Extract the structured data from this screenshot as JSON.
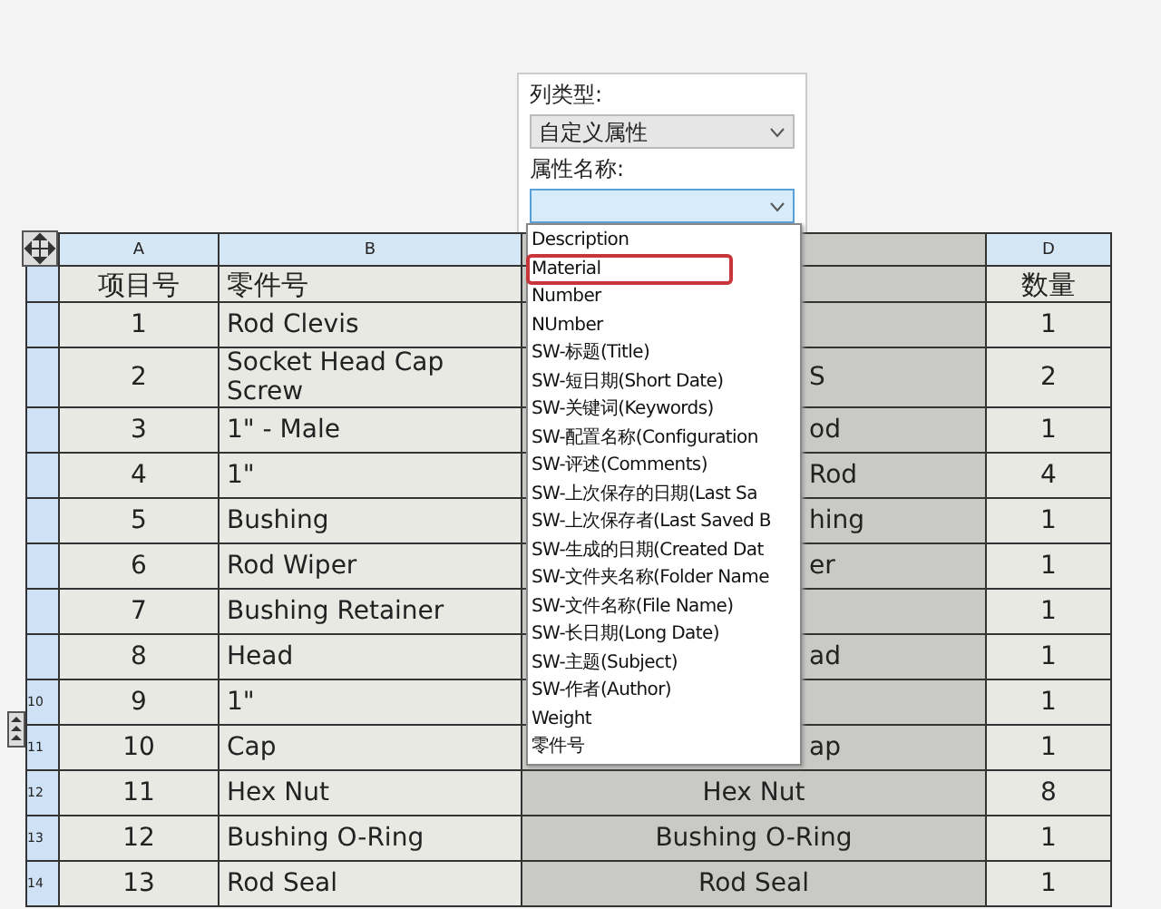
{
  "column_panel": {
    "column_type_label": "列类型:",
    "column_type_value": "自定义属性",
    "property_name_label": "属性名称:"
  },
  "property_dropdown": {
    "items": [
      {
        "label": "Description",
        "highlighted": false
      },
      {
        "label": "Material",
        "highlighted": true
      },
      {
        "label": "Number",
        "highlighted": false
      },
      {
        "label": "NUmber",
        "highlighted": false
      },
      {
        "label": "SW-标题(Title)",
        "highlighted": false
      },
      {
        "label": "SW-短日期(Short Date)",
        "highlighted": false
      },
      {
        "label": "SW-关键词(Keywords)",
        "highlighted": false
      },
      {
        "label": "SW-配置名称(Configuration",
        "highlighted": false
      },
      {
        "label": "SW-评述(Comments)",
        "highlighted": false
      },
      {
        "label": "SW-上次保存的日期(Last Sa",
        "highlighted": false
      },
      {
        "label": "SW-上次保存者(Last Saved B",
        "highlighted": false
      },
      {
        "label": "SW-生成的日期(Created Dat",
        "highlighted": false
      },
      {
        "label": "SW-文件夹名称(Folder Name",
        "highlighted": false
      },
      {
        "label": "SW-文件名称(File Name)",
        "highlighted": false
      },
      {
        "label": "SW-长日期(Long Date)",
        "highlighted": false
      },
      {
        "label": "SW-主题(Subject)",
        "highlighted": false
      },
      {
        "label": "SW-作者(Author)",
        "highlighted": false
      },
      {
        "label": "Weight",
        "highlighted": false
      },
      {
        "label": "零件号",
        "highlighted": false
      }
    ]
  },
  "table": {
    "column_letters": {
      "a": "A",
      "b": "B",
      "d": "D"
    },
    "headings": {
      "a": "项目号",
      "b": "零件号",
      "d": "数量"
    },
    "rows": [
      {
        "item": "1",
        "part": "Rod Clevis",
        "qty": "1"
      },
      {
        "item": "2",
        "part": "Socket Head Cap Screw",
        "column_3": {
          "text": "S",
          "kind": "tail"
        },
        "qty": "2"
      },
      {
        "item": "3",
        "part": "1\" - Male",
        "column_3": {
          "text": "od",
          "kind": "tail"
        },
        "qty": "1"
      },
      {
        "item": "4",
        "part": "1\"",
        "column_3": {
          "text": "Rod",
          "kind": "tail"
        },
        "qty": "4"
      },
      {
        "item": "5",
        "part": "Bushing",
        "column_3": {
          "text": "hing",
          "kind": "tail"
        },
        "qty": "1"
      },
      {
        "item": "6",
        "part": "Rod Wiper",
        "column_3": {
          "text": "er",
          "kind": "tail"
        },
        "qty": "1"
      },
      {
        "item": "7",
        "part": "Bushing Retainer",
        "qty": "1"
      },
      {
        "item": "8",
        "part": "Head",
        "column_3": {
          "text": "ad",
          "kind": "tail"
        },
        "qty": "1"
      },
      {
        "row_number": "10",
        "item": "9",
        "part": "1\"",
        "qty": "1"
      },
      {
        "row_number": "11",
        "item": "10",
        "part": "Cap",
        "column_3": {
          "text": "ap",
          "kind": "tail"
        },
        "qty": "1"
      },
      {
        "row_number": "12",
        "item": "11",
        "part": "Hex Nut",
        "column_3": {
          "text": "Hex Nut",
          "kind": "full"
        },
        "qty": "8"
      },
      {
        "row_number": "13",
        "item": "12",
        "part": "Bushing O-Ring",
        "column_3": {
          "text": "Bushing O-Ring",
          "kind": "full"
        },
        "qty": "1"
      },
      {
        "row_number": "14",
        "item": "13",
        "part": "Rod Seal",
        "column_3": {
          "text": "Rod Seal",
          "kind": "full"
        },
        "qty": "1"
      }
    ]
  }
}
